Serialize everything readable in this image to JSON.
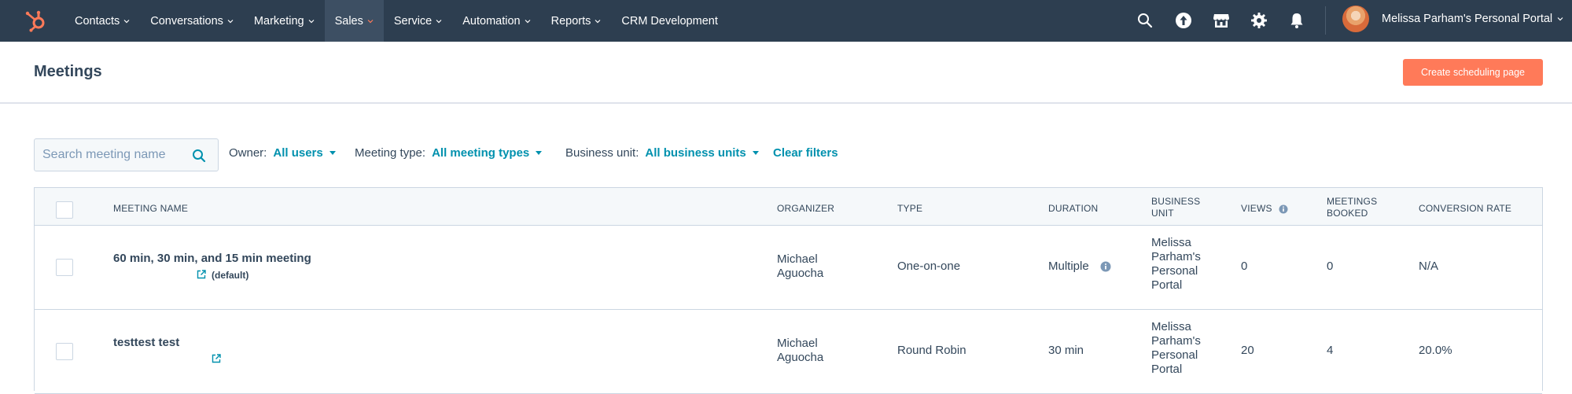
{
  "nav": {
    "items": [
      {
        "label": "Contacts"
      },
      {
        "label": "Conversations"
      },
      {
        "label": "Marketing"
      },
      {
        "label": "Sales",
        "active": true
      },
      {
        "label": "Service"
      },
      {
        "label": "Automation"
      },
      {
        "label": "Reports"
      },
      {
        "label": "CRM Development",
        "no_chevron": true
      }
    ],
    "portal_name": "Melissa Parham's Personal Portal",
    "icons": [
      "search-icon",
      "upgrade-icon",
      "marketplace-icon",
      "settings-icon",
      "notifications-icon"
    ],
    "accent_color": "#ff7a59"
  },
  "header": {
    "title": "Meetings",
    "create_button": "Create scheduling page"
  },
  "filters": {
    "search_placeholder": "Search meeting name",
    "owner_label": "Owner:",
    "owner_value": "All users",
    "type_label": "Meeting type:",
    "type_value": "All meeting types",
    "bu_label": "Business unit:",
    "bu_value": "All business units",
    "clear": "Clear filters"
  },
  "table": {
    "columns": {
      "name": "Meeting name",
      "organizer": "Organizer",
      "type": "Type",
      "duration": "Duration",
      "business_unit_1": "Business",
      "business_unit_2": "unit",
      "views": "Views",
      "booked_1": "Meetings",
      "booked_2": "booked",
      "conversion": "Conversion rate"
    },
    "rows": [
      {
        "name": "60 min, 30 min, and 15 min meeting",
        "tag": "(default)",
        "organizer_1": "Michael",
        "organizer_2": "Aguocha",
        "type": "One-on-one",
        "duration": "Multiple",
        "bu_1": "Melissa",
        "bu_2": "Parham's",
        "bu_3": "Personal",
        "bu_4": "Portal",
        "views": "0",
        "booked": "0",
        "conversion": "N/A"
      },
      {
        "name": "testtest test",
        "tag": "",
        "organizer_1": "Michael",
        "organizer_2": "Aguocha",
        "type": "Round Robin",
        "duration": "30 min",
        "bu_1": "Melissa",
        "bu_2": "Parham's",
        "bu_3": "Personal",
        "bu_4": "Portal",
        "views": "20",
        "booked": "4",
        "conversion": "20.0%"
      }
    ]
  }
}
